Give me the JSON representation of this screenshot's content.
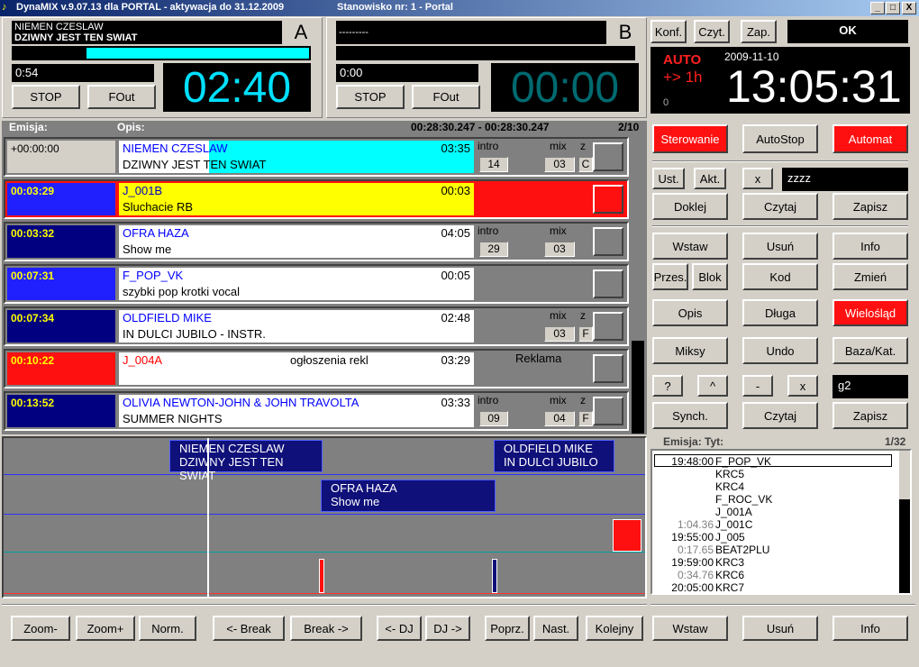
{
  "window": {
    "title": "DynaMIX v.9.07.13 dla PORTAL - aktywacja do 31.12.2009",
    "station": "Stanowisko nr: 1 - Portal",
    "min": "_",
    "max": "□",
    "close": "X"
  },
  "deckA": {
    "line1": "NIEMEN CZESLAW",
    "line2": "DZIWNY JEST TEN SWIAT",
    "letter": "A",
    "elapsed": "0:54",
    "time": "02:40",
    "stop": "STOP",
    "fout": "FOut",
    "progress": 0.25
  },
  "deckB": {
    "line1": "---------",
    "letter": "B",
    "elapsed": "0:00",
    "time": "00:00",
    "stop": "STOP",
    "fout": "FOut"
  },
  "top_right": {
    "konf": "Konf.",
    "czyt": "Czyt.",
    "zap": "Zap.",
    "ok": "OK",
    "auto": "AUTO",
    "plus": "+> 1h",
    "date": "2009-11-10",
    "clock": "13:05:31",
    "zero": "0"
  },
  "playlist_header": {
    "emisja": "Emisja:",
    "opis": "Opis:",
    "range": "00:28:30.247 - 00:28:30.247",
    "page": "2/10"
  },
  "rows": [
    {
      "time": "+00:00:00",
      "l1": "NIEMEN CZESLAW",
      "l2": "DZIWNY JEST TEN SWIAT",
      "dur": "03:35",
      "intro_label": "intro",
      "intro": "14",
      "mix_label": "mix",
      "mix": "03",
      "z_label": "z",
      "z": "C"
    },
    {
      "time": "00:03:29",
      "l1": "J_001B",
      "l2": "Sluchacie RB",
      "dur": "00:03"
    },
    {
      "time": "00:03:32",
      "l1": "OFRA HAZA",
      "l2": "Show me",
      "dur": "04:05",
      "intro_label": "intro",
      "intro": "29",
      "mix_label": "mix",
      "mix": "03"
    },
    {
      "time": "00:07:31",
      "l1": "F_POP_VK",
      "l2": "szybki pop krotki vocal",
      "dur": "00:05"
    },
    {
      "time": "00:07:34",
      "l1": "OLDFIELD MIKE",
      "l2": "IN DULCI JUBILO - INSTR.",
      "dur": "02:48",
      "mix_label": "mix",
      "mix": "03",
      "z_label": "z",
      "z": "F"
    },
    {
      "time": "00:10:22",
      "l1": "J_004A",
      "mid": "ogłoszenia rekl",
      "dur": "03:29",
      "note": "Reklama"
    },
    {
      "time": "00:13:52",
      "l1": "OLIVIA NEWTON-JOHN & JOHN TRAVOLTA",
      "l2": "SUMMER NIGHTS",
      "dur": "03:33",
      "intro_label": "intro",
      "intro": "09",
      "mix_label": "mix",
      "mix": "04",
      "z_label": "z",
      "z": "F"
    }
  ],
  "control": {
    "sterowanie": "Sterowanie",
    "autostop": "AutoStop",
    "automat": "Automat",
    "ust": "Ust.",
    "akt": "Akt.",
    "x": "x",
    "field1": "zzzz",
    "doklej": "Doklej",
    "czytaj": "Czytaj",
    "zapisz": "Zapisz",
    "wstaw": "Wstaw",
    "usun": "Usuń",
    "info": "Info",
    "przes": "Przes.",
    "blok": "Blok",
    "kod": "Kod",
    "zmien": "Zmień",
    "opis": "Opis",
    "dluga": "Długa",
    "wieloslad": "Wielośląd",
    "miksy": "Miksy",
    "undo": "Undo",
    "baza": "Baza/Kat.",
    "q": "?",
    "caret": "^",
    "minus": "-",
    "x2": "x",
    "field2": "g2",
    "synch": "Synch.",
    "czytaj2": "Czytaj",
    "zapisz2": "Zapisz"
  },
  "timeline": {
    "b1l1": "NIEMEN CZESLAW",
    "b1l2": "DZIWNY JEST TEN SWIAT",
    "b2l1": "OLDFIELD MIKE",
    "b2l2": "IN DULCI JUBILO",
    "b3l1": "OFRA HAZA",
    "b3l2": "Show me"
  },
  "schedule": {
    "header": "Emisja: Tyt:",
    "page": "1/32",
    "items": [
      {
        "t": "19:48:00",
        "n": "F_POP_VK"
      },
      {
        "t": "",
        "n": "KRC5"
      },
      {
        "t": "",
        "n": "KRC4"
      },
      {
        "t": "",
        "n": "F_ROC_VK"
      },
      {
        "t": "",
        "n": "J_001A"
      },
      {
        "t": "1:04.36",
        "n": "J_001C"
      },
      {
        "t": "19:55:00",
        "n": "J_005"
      },
      {
        "t": "0:17.65",
        "n": "BEAT2PLU"
      },
      {
        "t": "19:59:00",
        "n": "KRC3"
      },
      {
        "t": "0:34.76",
        "n": "KRC6"
      },
      {
        "t": "20:05:00",
        "n": "KRC7"
      }
    ]
  },
  "bottom": {
    "zoom_minus": "Zoom-",
    "zoom_plus": "Zoom+",
    "norm": "Norm.",
    "break_l": "<- Break",
    "break_r": "Break ->",
    "dj_l": "<- DJ",
    "dj_r": "DJ ->",
    "poprz": "Poprz.",
    "nast": "Nast.",
    "kolejny": "Kolejny",
    "wstaw": "Wstaw",
    "usun": "Usuń",
    "info": "Info"
  }
}
